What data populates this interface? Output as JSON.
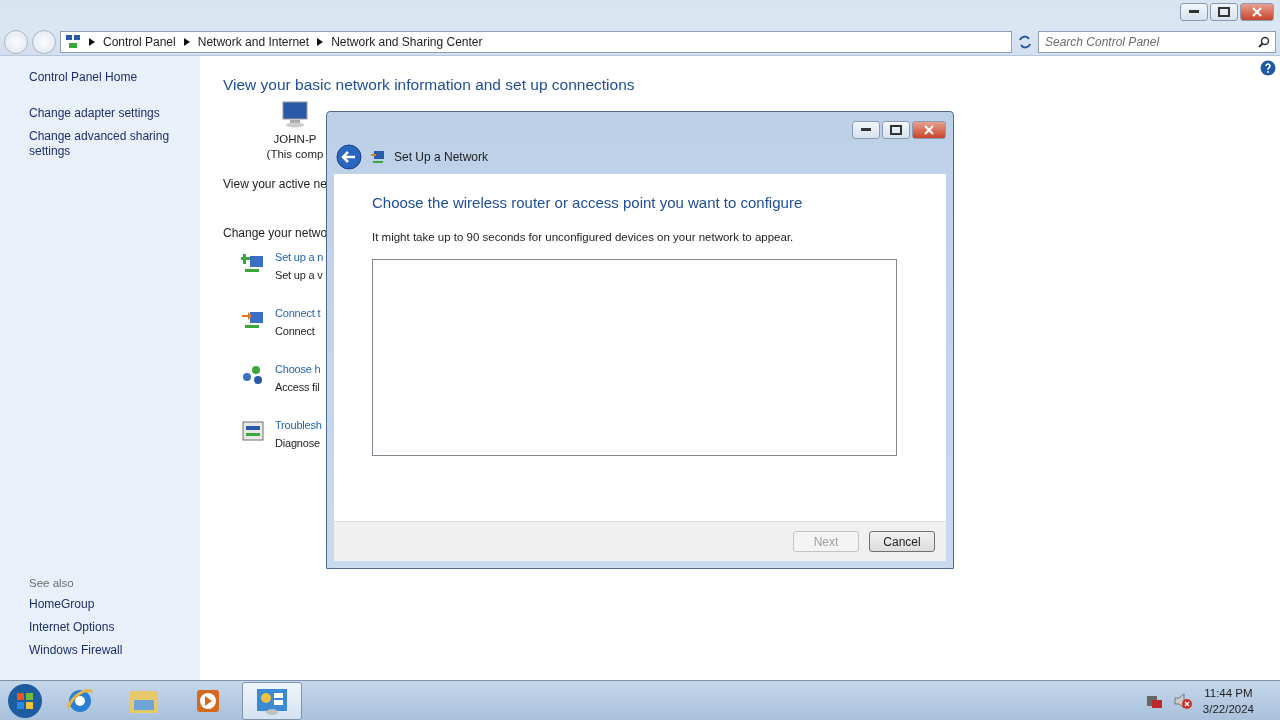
{
  "address_bar": {
    "breadcrumbs": [
      "Control Panel",
      "Network and Internet",
      "Network and Sharing Center"
    ]
  },
  "search": {
    "placeholder": "Search Control Panel"
  },
  "sidebar": {
    "items": [
      "Control Panel Home",
      "Change adapter settings",
      "Change advanced sharing settings"
    ],
    "see_also": {
      "heading": "See also",
      "items": [
        "HomeGroup",
        "Internet Options",
        "Windows Firewall"
      ]
    }
  },
  "main": {
    "heading": "View your basic network information and set up connections",
    "computer": {
      "name": "JOHN-P",
      "caption": "(This comp"
    },
    "active_networks_label": "View your active ne",
    "change_label": "Change your netwo",
    "tasks": [
      {
        "kind": "setup",
        "title": "Set up a n",
        "description": "Set up a v"
      },
      {
        "kind": "connect",
        "title": "Connect t",
        "description": "Connect"
      },
      {
        "kind": "homegroup",
        "title": "Choose h",
        "description": "Access fil"
      },
      {
        "kind": "troubleshoot",
        "title": "Troublesh",
        "description": "Diagnose"
      }
    ]
  },
  "dialog": {
    "title": "Set Up a Network",
    "heading": "Choose the wireless router or access point you want to configure",
    "message": "It might take up to 90 seconds for unconfigured devices on your network to appear.",
    "buttons": [
      {
        "label": "Next",
        "disabled": true
      },
      {
        "label": "Cancel",
        "disabled": false
      }
    ]
  },
  "taskbar": {
    "apps": [
      {
        "kind": "browser",
        "selected": false
      },
      {
        "kind": "folder",
        "selected": false
      },
      {
        "kind": "media",
        "selected": false
      },
      {
        "kind": "control",
        "selected": true
      }
    ],
    "clock": {
      "time": "11:44 PM",
      "date": "3/22/2024"
    }
  }
}
